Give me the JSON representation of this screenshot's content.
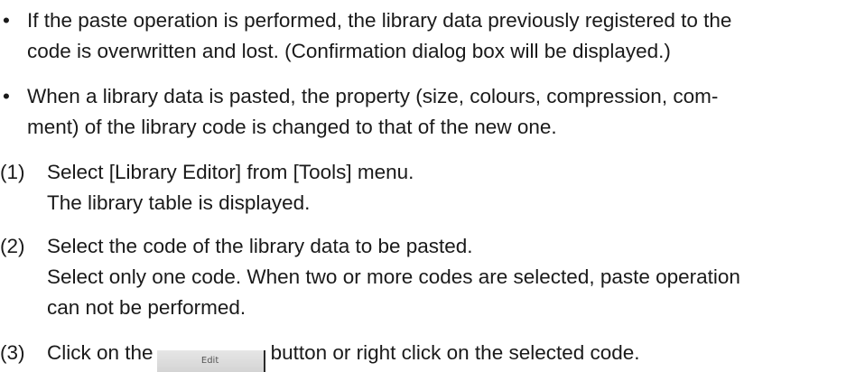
{
  "bullets": [
    {
      "mark": "•",
      "lines": [
        "If the paste operation is performed, the library data previously registered to the",
        "code is overwritten and lost. (Confirmation dialog box will be displayed.)"
      ]
    },
    {
      "mark": "•",
      "lines": [
        "When a library data is pasted, the property (size, colours, compression, com-",
        "ment) of the library code is changed to that of the new one."
      ]
    }
  ],
  "steps": [
    {
      "number": "(1)",
      "lines": [
        "Select [Library Editor] from [Tools] menu.",
        "The library table is displayed."
      ]
    },
    {
      "number": "(2)",
      "lines": [
        "Select the code of the library data to be pasted.",
        "Select only one code. When two or more codes are selected, paste operation",
        "can not be performed."
      ]
    },
    {
      "number": "(3)",
      "before_button": "Click on the",
      "button_label": "Edit",
      "after_button": "button or right click on the selected code."
    }
  ]
}
